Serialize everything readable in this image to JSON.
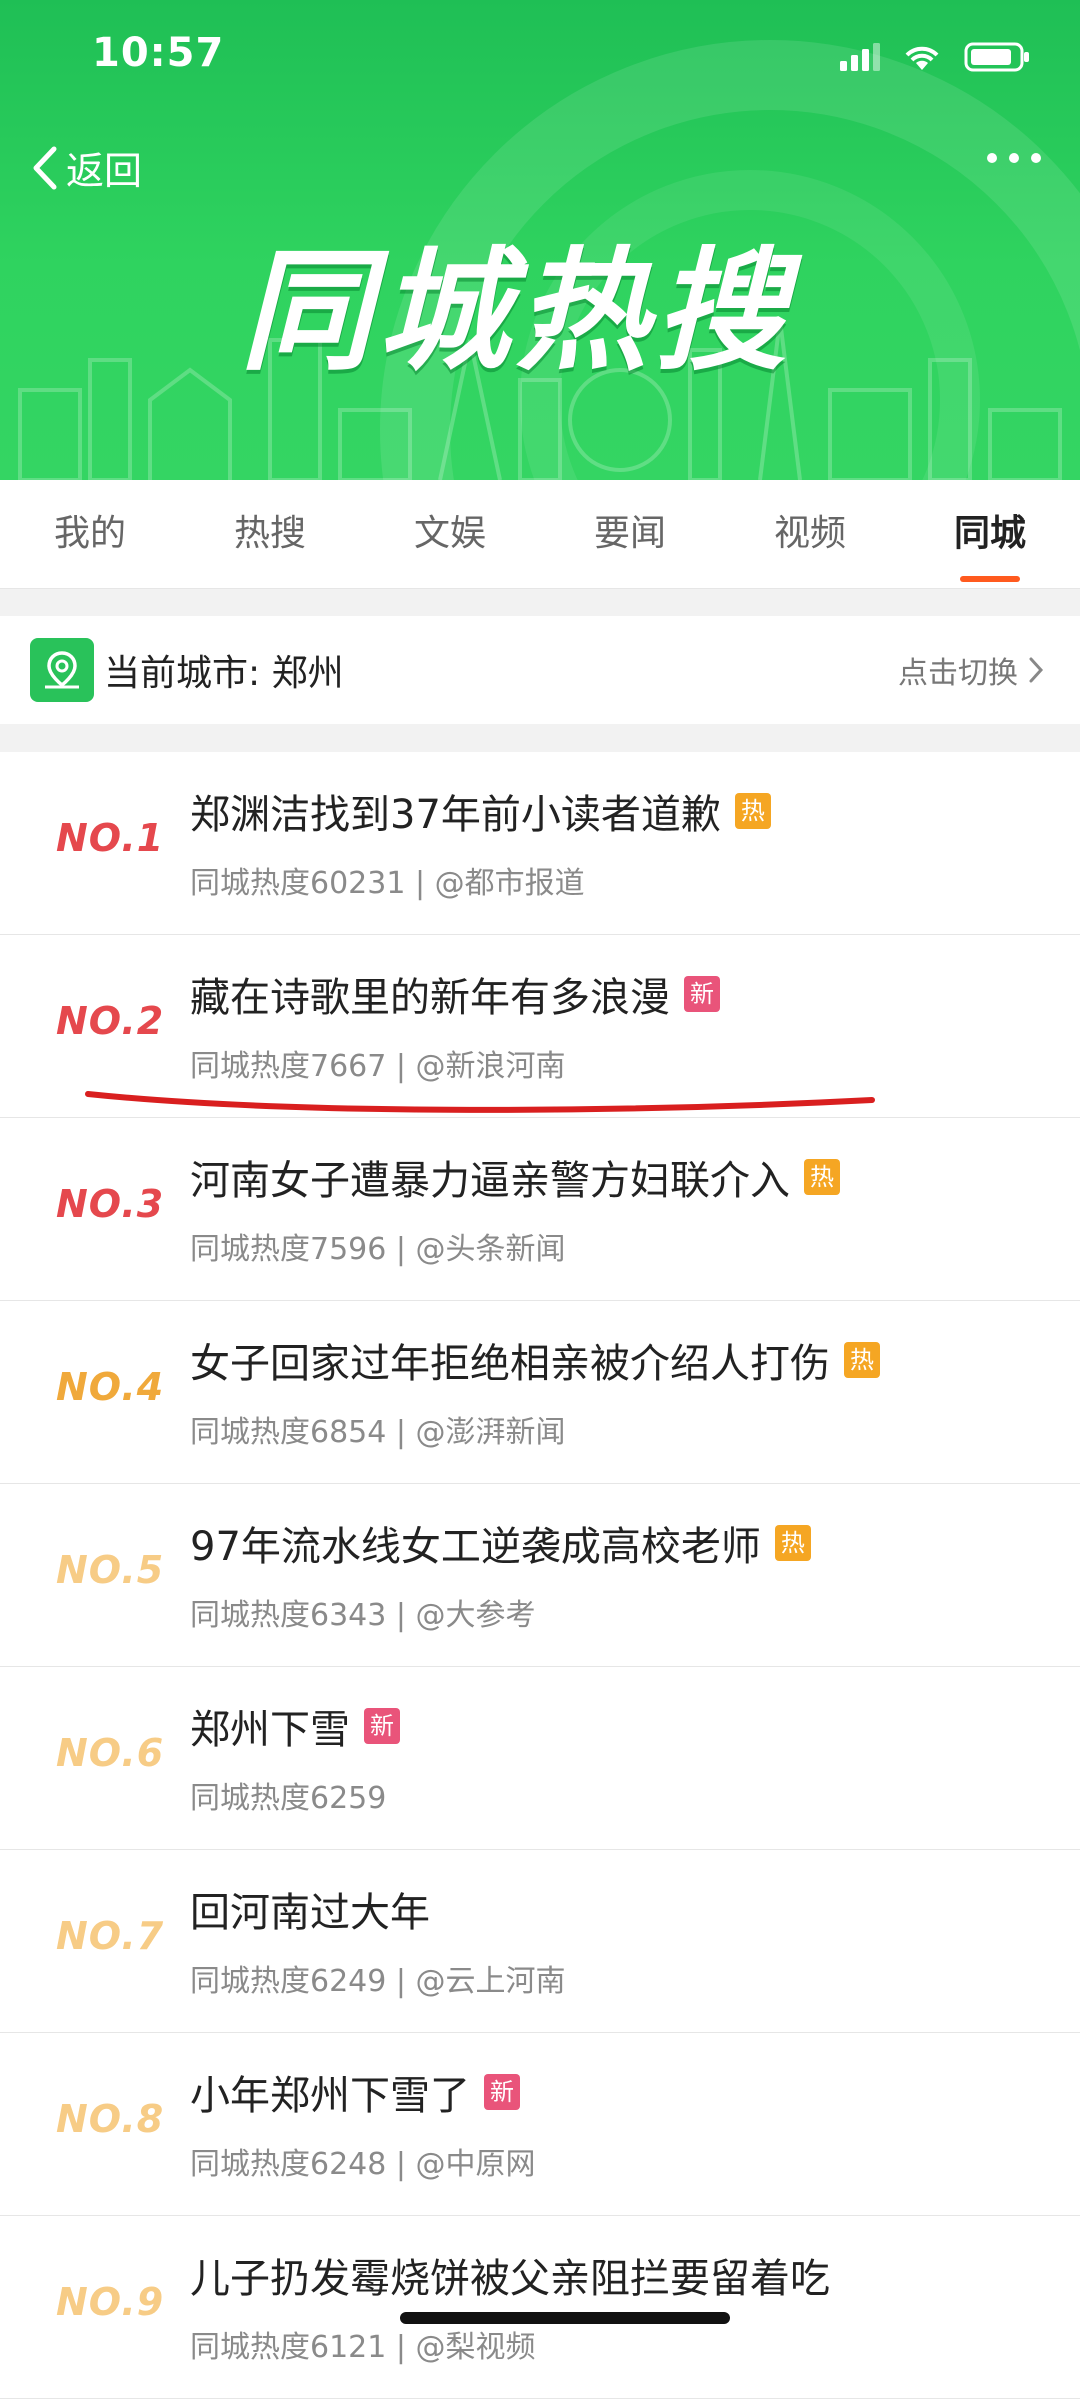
{
  "status_bar": {
    "time": "10:57"
  },
  "nav": {
    "back_label": "返回"
  },
  "hero": {
    "title": "同城热搜"
  },
  "tabs": [
    {
      "label": "我的",
      "active": false
    },
    {
      "label": "热搜",
      "active": false
    },
    {
      "label": "文娱",
      "active": false
    },
    {
      "label": "要闻",
      "active": false
    },
    {
      "label": "视频",
      "active": false
    },
    {
      "label": "同城",
      "active": true
    }
  ],
  "city": {
    "label": "当前城市: 郑州",
    "switch_label": "点击切换"
  },
  "colors": {
    "header_green": "#2fd35f",
    "accent_orange": "#ff5a1e",
    "hot_badge": "#f5a623",
    "new_badge": "#e9547a",
    "annotation_red": "#d91f1f"
  },
  "items": [
    {
      "rank": "NO.1",
      "title": "郑渊洁找到37年前小读者道歉",
      "badge": "热",
      "badge_type": "hot",
      "meta": "同城热度60231 | @都市报道"
    },
    {
      "rank": "NO.2",
      "title": "藏在诗歌里的新年有多浪漫",
      "badge": "新",
      "badge_type": "new",
      "meta": "同城热度7667 | @新浪河南"
    },
    {
      "rank": "NO.3",
      "title": "河南女子遭暴力逼亲警方妇联介入",
      "badge": "热",
      "badge_type": "hot",
      "meta": "同城热度7596 | @头条新闻"
    },
    {
      "rank": "NO.4",
      "title": "女子回家过年拒绝相亲被介绍人打伤",
      "badge": "热",
      "badge_type": "hot",
      "meta": "同城热度6854 | @澎湃新闻"
    },
    {
      "rank": "NO.5",
      "title": "97年流水线女工逆袭成高校老师",
      "badge": "热",
      "badge_type": "hot",
      "meta": "同城热度6343 | @大参考"
    },
    {
      "rank": "NO.6",
      "title": "郑州下雪",
      "badge": "新",
      "badge_type": "new",
      "meta": "同城热度6259"
    },
    {
      "rank": "NO.7",
      "title": "回河南过大年",
      "badge": "",
      "badge_type": "",
      "meta": "同城热度6249 | @云上河南"
    },
    {
      "rank": "NO.8",
      "title": "小年郑州下雪了",
      "badge": "新",
      "badge_type": "new",
      "meta": "同城热度6248 | @中原网"
    },
    {
      "rank": "NO.9",
      "title": "儿子扔发霉烧饼被父亲阻拦要留着吃",
      "badge": "",
      "badge_type": "",
      "meta": "同城热度6121 | @梨视频"
    }
  ]
}
